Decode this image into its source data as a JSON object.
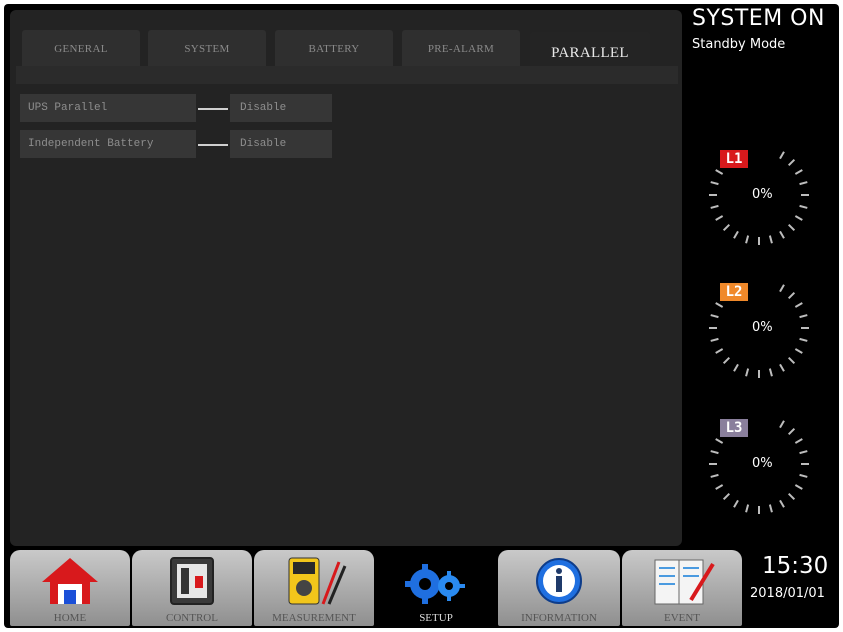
{
  "status": {
    "title": "SYSTEM ON",
    "mode": "Standby Mode"
  },
  "tabs": [
    {
      "label": "GENERAL",
      "active": false
    },
    {
      "label": "SYSTEM",
      "active": false
    },
    {
      "label": "BATTERY",
      "active": false
    },
    {
      "label": "PRE-ALARM",
      "active": false
    },
    {
      "label": "PARALLEL",
      "active": true
    }
  ],
  "settings": [
    {
      "label": "UPS Parallel",
      "value": "Disable"
    },
    {
      "label": "Independent Battery",
      "value": "Disable"
    }
  ],
  "phases": [
    {
      "label": "L1",
      "value": "0%",
      "color": "#d8191c"
    },
    {
      "label": "L2",
      "value": "0%",
      "color": "#f0892a"
    },
    {
      "label": "L3",
      "value": "0%",
      "color": "#8a7f9c"
    }
  ],
  "nav": [
    {
      "label": "HOME",
      "icon": "home-icon",
      "active": false
    },
    {
      "label": "CONTROL",
      "icon": "control-icon",
      "active": false
    },
    {
      "label": "MEASUREMENT",
      "icon": "multimeter-icon",
      "active": false
    },
    {
      "label": "SETUP",
      "icon": "gears-icon",
      "active": true
    },
    {
      "label": "INFORMATION",
      "icon": "info-icon",
      "active": false
    },
    {
      "label": "EVENT",
      "icon": "event-log-icon",
      "active": false
    }
  ],
  "clock": {
    "time": "15:30",
    "date": "2018/01/01"
  }
}
